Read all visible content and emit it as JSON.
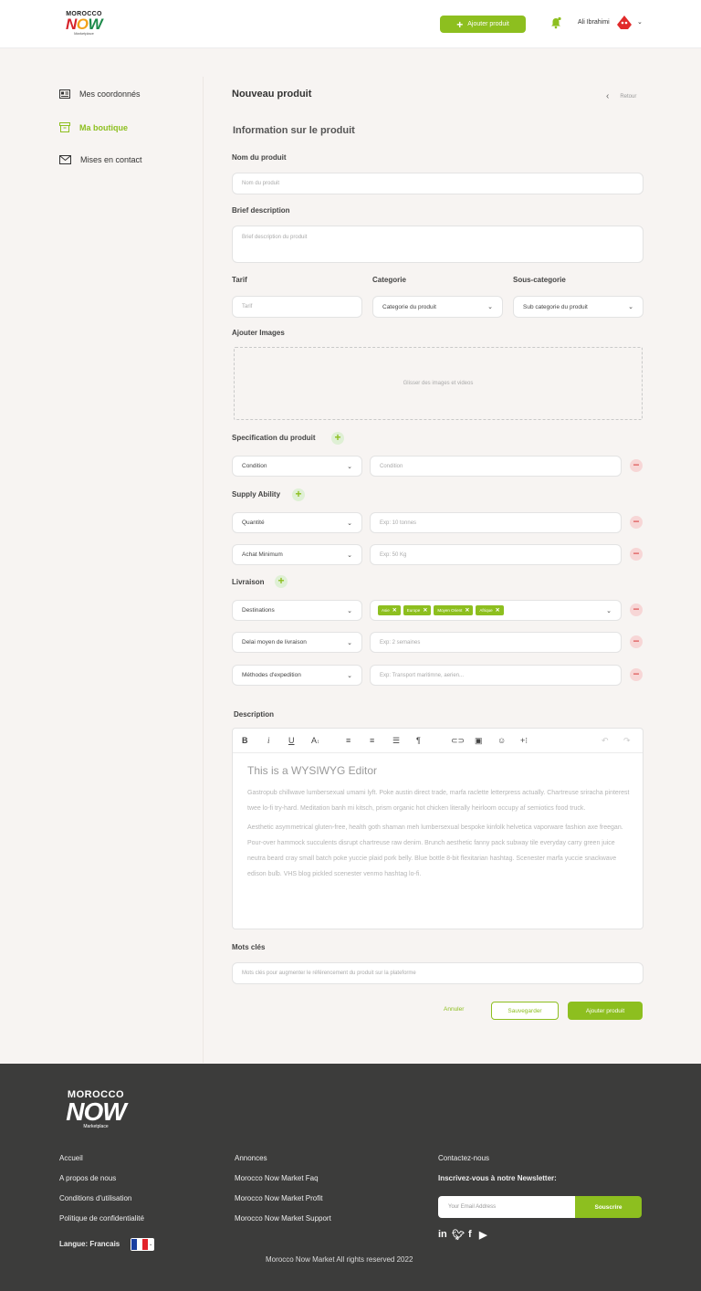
{
  "header": {
    "logo": {
      "line1": "MOROCCO",
      "line2": "NOW",
      "line3": "Marketplace"
    },
    "add_button": "Ajouter produit",
    "user_name": "Ali Ibrahimi"
  },
  "sidebar": {
    "items": [
      {
        "label": "Mes coordonnés",
        "icon": "id-card-icon"
      },
      {
        "label": "Ma boutique",
        "icon": "archive-box-icon",
        "active": true
      },
      {
        "label": "Mises en contact",
        "icon": "envelope-icon"
      }
    ]
  },
  "main": {
    "title": "Nouveau produit",
    "back_label": "Retour",
    "section_title": "Information sur le produit",
    "name": {
      "label": "Nom du produit",
      "placeholder": "Nom du produit"
    },
    "brief": {
      "label": "Brief description",
      "placeholder": "Brief description du produit"
    },
    "tarif": {
      "label": "Tarif",
      "placeholder": "Tarif"
    },
    "categorie": {
      "label": "Categorie",
      "value": "Categorie du produit"
    },
    "sous_categorie": {
      "label": "Sous-categorie",
      "value": "Sub categorie du produit"
    },
    "images": {
      "label": "Ajouter Images",
      "placeholder": "Glisser des images et videos"
    },
    "specification": {
      "label": "Specification du produit",
      "select": "Condition",
      "placeholder": "Condition"
    },
    "supply": {
      "label": "Supply Ability",
      "rows": [
        {
          "select": "Quantité",
          "placeholder": "Exp: 10 tonnes"
        },
        {
          "select": "Achat Minimum",
          "placeholder": "Exp: 50 Kg"
        }
      ]
    },
    "livraison": {
      "label": "Livraison",
      "destinations": {
        "select": "Destinations",
        "tags": [
          "Asie",
          "Europe",
          "Moyen Orient",
          "Afrique"
        ]
      },
      "rows": [
        {
          "select": "Delai moyen de livraison",
          "placeholder": "Exp: 2 semaines"
        },
        {
          "select": "Méthodes d'expedition",
          "placeholder": "Exp: Transport maritimne, aerien..."
        }
      ]
    },
    "description": {
      "label": "Description",
      "heading": "This is a WYSIWYG Editor",
      "paragraph1": "Gastropub chillwave lumbersexual umami lyft. Poke austin direct trade, marfa raclette letterpress actually. Chartreuse sriracha pinterest twee lo-fi try-hard. Meditation banh mi kitsch, prism organic hot chicken literally heirloom occupy af semiotics food truck.",
      "paragraph2": "Aesthetic asymmetrical gluten-free, health goth shaman meh lumbersexual bespoke kinfolk helvetica vaporware fashion axe freegan. Pour-over hammock succulents disrupt chartreuse raw denim. Brunch aesthetic fanny pack subway tile everyday carry green juice neutra beard cray small batch poke yuccie plaid pork belly. Blue bottle 8-bit flexitarian hashtag. Scenester marfa yuccie snackwave edison bulb. VHS blog pickled scenester venmo hashtag lo-fi."
    },
    "keywords": {
      "label": "Mots clés",
      "placeholder": "Mots clés pour augmenter le référencement du produit sur la plateforme"
    },
    "actions": {
      "cancel": "Annuler",
      "save": "Sauvegarder",
      "add": "Ajouter produit"
    }
  },
  "footer": {
    "logo": {
      "line1": "MOROCCO",
      "line2": "NOW",
      "line3": "Marketplace"
    },
    "col1": [
      "Accueil",
      "A propos de nous",
      "Conditions d'utilisation",
      "Politique de confidentialité"
    ],
    "col2": [
      "Annonces",
      "Morocco Now Market Faq",
      "Morocco Now Market Profit",
      "Morocco Now Market Support"
    ],
    "contact": "Contactez-nous",
    "newsletter_title": "Inscrivez-vous à notre Newsletter:",
    "email_placeholder": "Your Email Address",
    "subscribe": "Souscrire",
    "language": "Langue: Francais",
    "copyright": "Morocco Now Market  All rights reserved 2022"
  },
  "colors": {
    "accent": "#8dbf1f",
    "footer_bg": "#3c3c3b",
    "danger": "#e06060"
  }
}
